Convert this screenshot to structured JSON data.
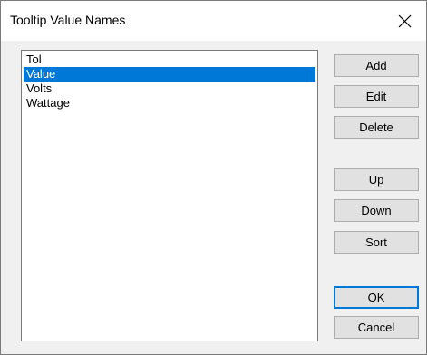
{
  "window": {
    "title": "Tooltip Value Names",
    "close_glyph": "close-icon"
  },
  "list": {
    "items": [
      "Tol",
      "Value",
      "Volts",
      "Wattage"
    ],
    "selected_index": 1
  },
  "buttons": {
    "add": "Add",
    "edit": "Edit",
    "delete": "Delete",
    "up": "Up",
    "down": "Down",
    "sort": "Sort",
    "ok": "OK",
    "cancel": "Cancel"
  },
  "colors": {
    "selection": "#0078d7",
    "dialog_bg": "#f0f0f0",
    "button_bg": "#e1e1e1"
  }
}
